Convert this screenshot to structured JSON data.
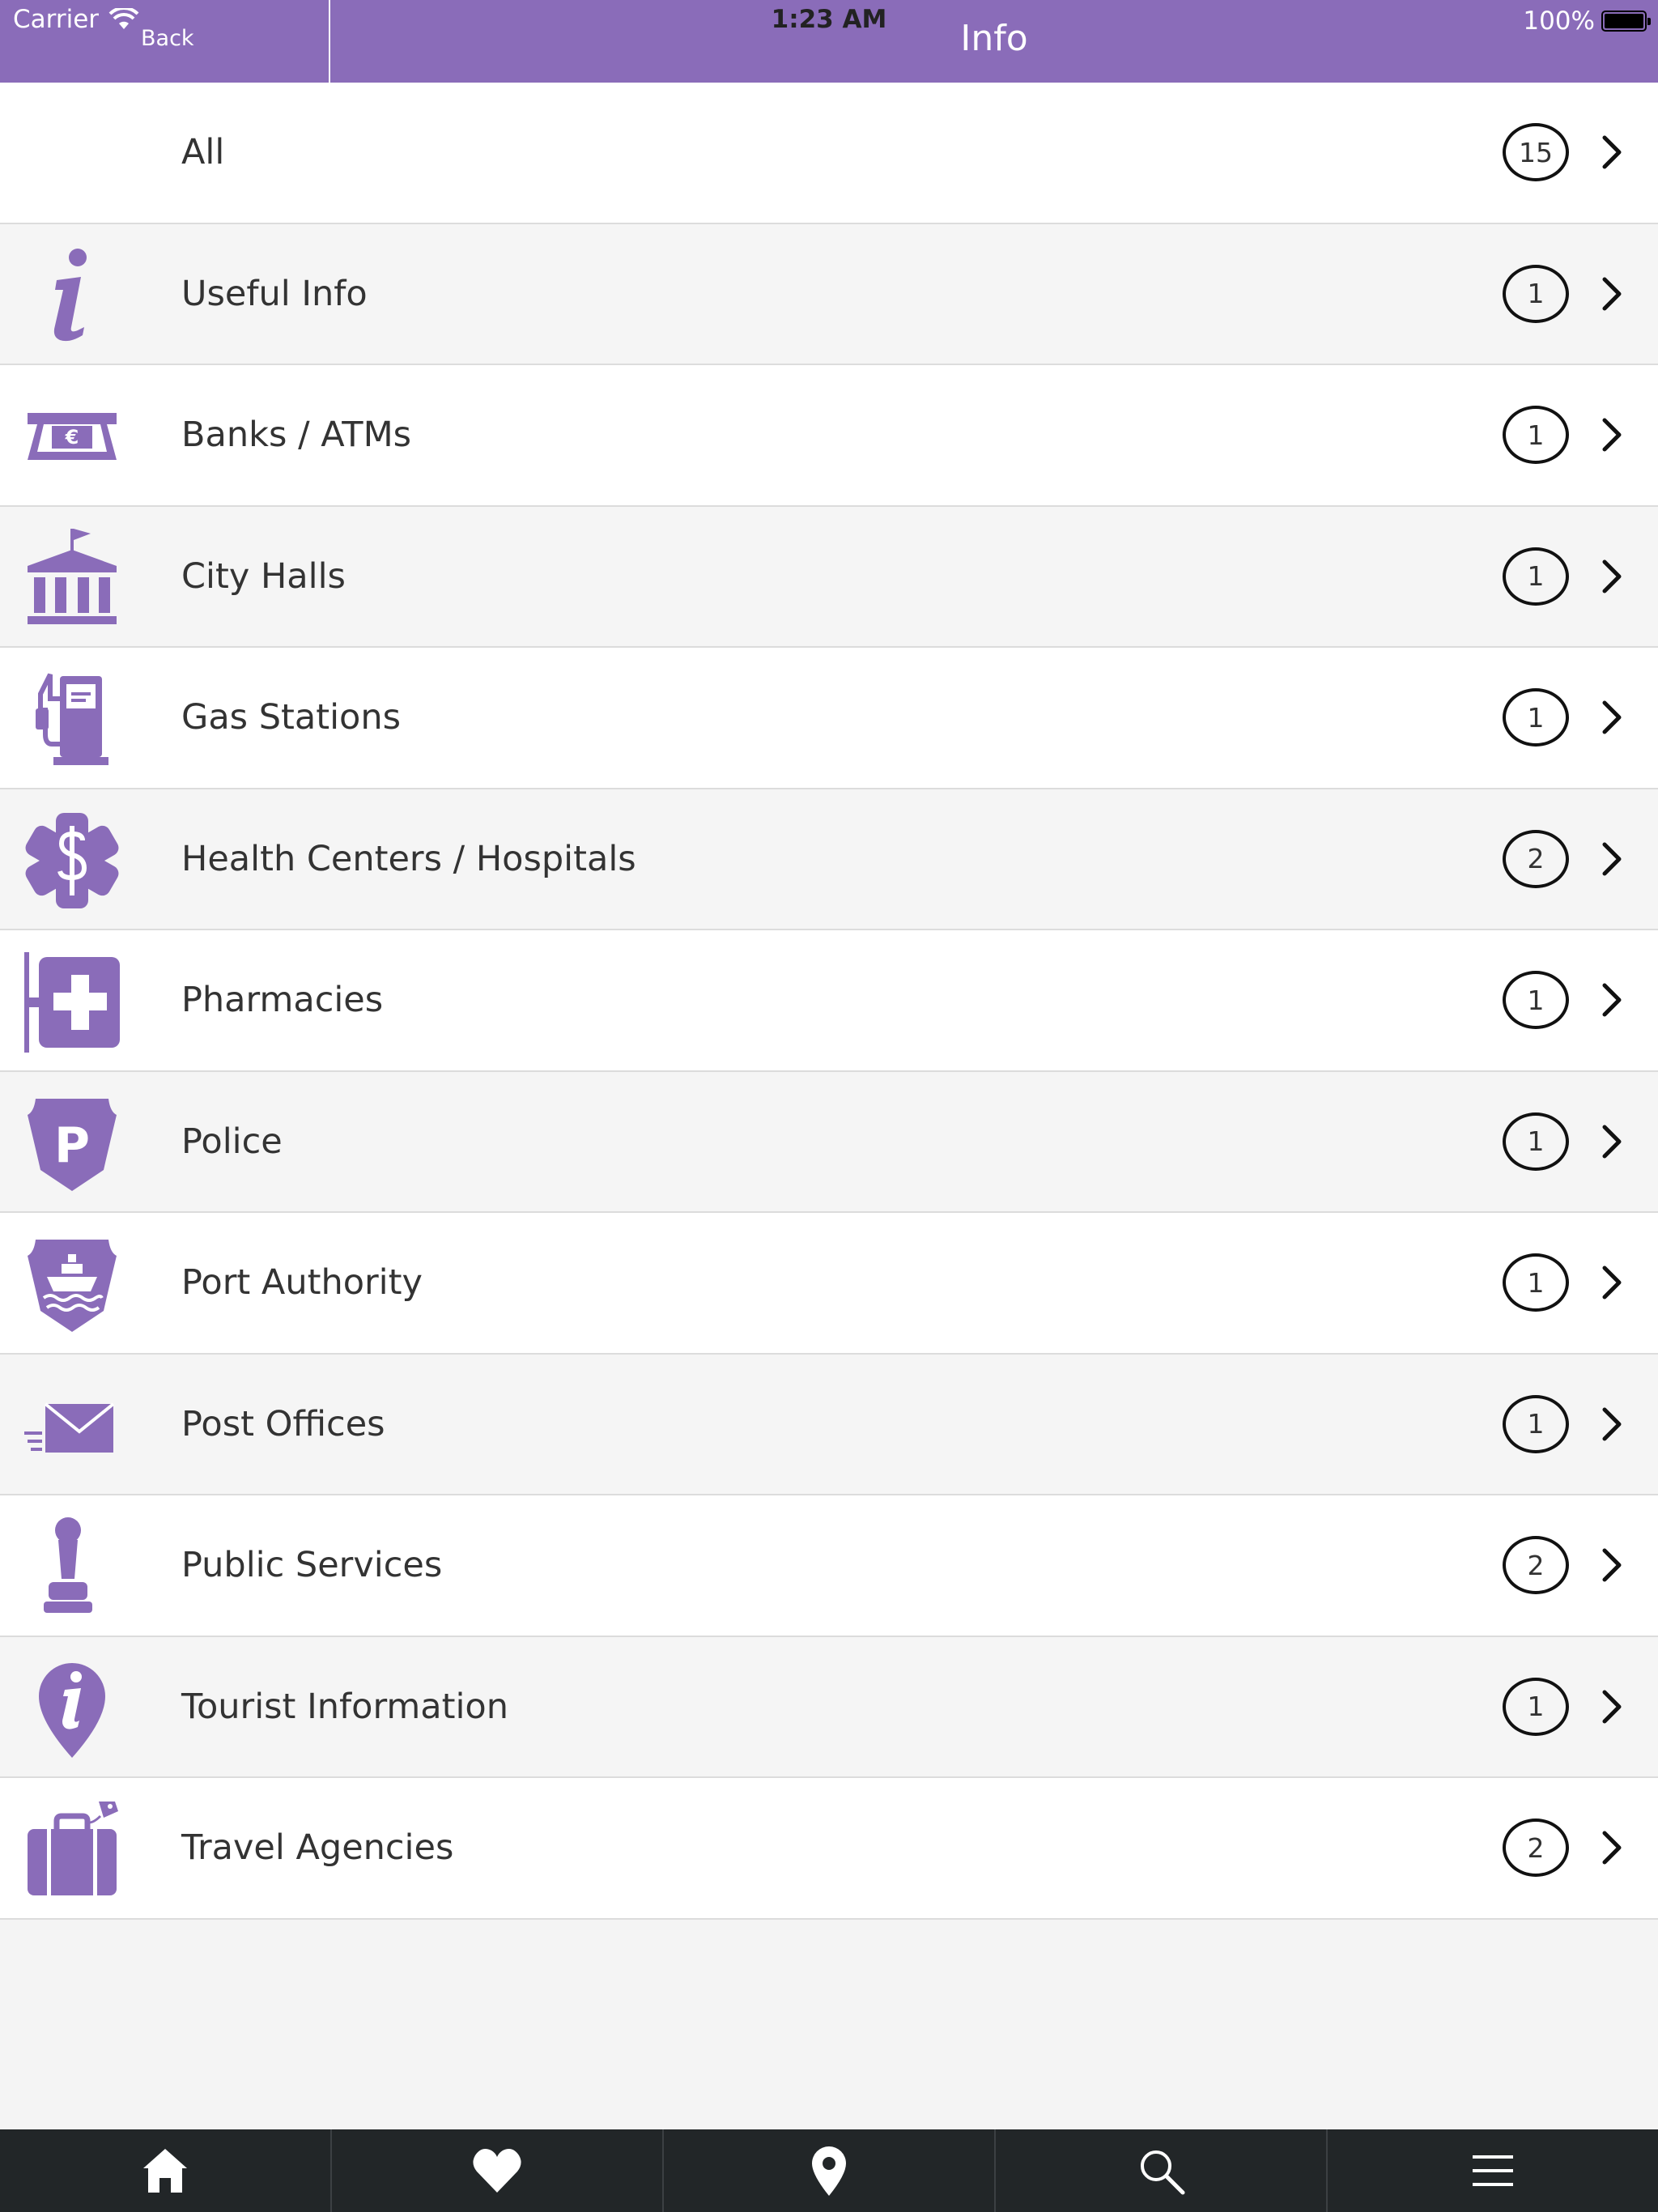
{
  "status_bar": {
    "carrier": "Carrier",
    "time": "1:23 AM",
    "battery": "100%"
  },
  "nav": {
    "back_label": "Back",
    "title": "Info"
  },
  "accent_color": "#8a6cb9",
  "categories": [
    {
      "label": "All",
      "count": "15",
      "icon": "none"
    },
    {
      "label": "Useful Info",
      "count": "1",
      "icon": "info-italic-icon"
    },
    {
      "label": "Banks / ATMs",
      "count": "1",
      "icon": "atm-euro-icon"
    },
    {
      "label": "City Halls",
      "count": "1",
      "icon": "city-hall-icon"
    },
    {
      "label": "Gas Stations",
      "count": "1",
      "icon": "gas-pump-icon"
    },
    {
      "label": "Health Centers / Hospitals",
      "count": "2",
      "icon": "medical-star-icon"
    },
    {
      "label": "Pharmacies",
      "count": "1",
      "icon": "pharmacy-sign-icon"
    },
    {
      "label": "Police",
      "count": "1",
      "icon": "police-badge-icon"
    },
    {
      "label": "Port Authority",
      "count": "1",
      "icon": "port-authority-badge-icon"
    },
    {
      "label": "Post Offices",
      "count": "1",
      "icon": "envelope-icon"
    },
    {
      "label": "Public Services",
      "count": "2",
      "icon": "rubber-stamp-icon"
    },
    {
      "label": "Tourist Information",
      "count": "1",
      "icon": "info-pin-icon"
    },
    {
      "label": "Travel Agencies",
      "count": "2",
      "icon": "suitcase-icon"
    }
  ],
  "tabbar": [
    {
      "icon": "home-icon"
    },
    {
      "icon": "heart-icon"
    },
    {
      "icon": "map-pin-icon"
    },
    {
      "icon": "search-icon"
    },
    {
      "icon": "menu-icon"
    }
  ]
}
